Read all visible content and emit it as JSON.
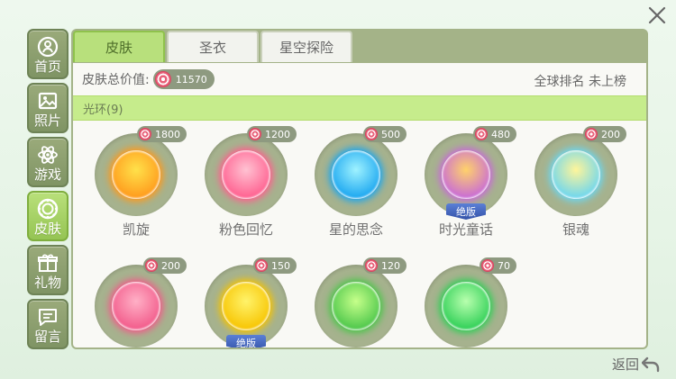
{
  "sidebar": {
    "items": [
      {
        "label": "首页",
        "icon": "home-icon",
        "active": false
      },
      {
        "label": "照片",
        "icon": "photo-icon",
        "active": false
      },
      {
        "label": "游戏",
        "icon": "atom-icon",
        "active": false
      },
      {
        "label": "皮肤",
        "icon": "ring-icon",
        "active": true
      },
      {
        "label": "礼物",
        "icon": "gift-icon",
        "active": false
      },
      {
        "label": "留言",
        "icon": "message-icon",
        "active": false
      }
    ]
  },
  "tabs": [
    {
      "label": "皮肤",
      "active": true
    },
    {
      "label": "圣衣",
      "active": false
    },
    {
      "label": "星空探险",
      "active": false
    }
  ],
  "summary": {
    "value_label": "皮肤总价值:",
    "value": "11570",
    "rank_label": "全球排名",
    "rank_value": "未上榜"
  },
  "category": {
    "label": "光环(9)"
  },
  "items": [
    {
      "name": "凯旋",
      "price": "1800",
      "colors": [
        "#ffe14a",
        "#ff9a1c"
      ],
      "limited": false
    },
    {
      "name": "粉色回忆",
      "price": "1200",
      "colors": [
        "#ffc2d2",
        "#ff5f8f"
      ],
      "limited": false
    },
    {
      "name": "星的思念",
      "price": "500",
      "colors": [
        "#9ff2ff",
        "#1aa6f0"
      ],
      "limited": false
    },
    {
      "name": "时光童话",
      "price": "480",
      "colors": [
        "#ffd26a",
        "#c86ad8"
      ],
      "limited": true
    },
    {
      "name": "银魂",
      "price": "200",
      "colors": [
        "#fff59a",
        "#6cd6f0"
      ],
      "limited": false
    },
    {
      "name": "",
      "price": "200",
      "colors": [
        "#ffb0c6",
        "#f25a8a"
      ],
      "limited": false
    },
    {
      "name": "",
      "price": "150",
      "colors": [
        "#fff36a",
        "#f7c400"
      ],
      "limited": true
    },
    {
      "name": "",
      "price": "120",
      "colors": [
        "#c6ff8a",
        "#4cc64a"
      ],
      "limited": false
    },
    {
      "name": "",
      "price": "70",
      "colors": [
        "#b8ffae",
        "#2fcf56"
      ],
      "limited": false
    }
  ],
  "limited_label": "绝版",
  "back_label": "返回",
  "accent": "#b8e07c"
}
